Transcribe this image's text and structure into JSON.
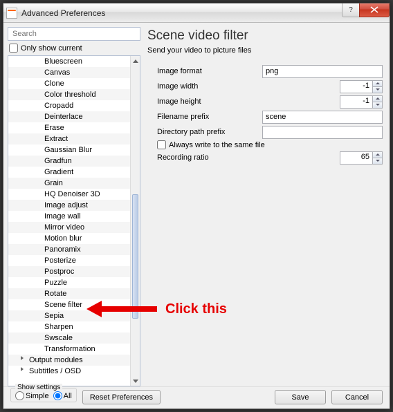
{
  "window": {
    "title": "Advanced Preferences"
  },
  "sidebar": {
    "search_placeholder": "Search",
    "only_show_current": "Only show current",
    "items": [
      {
        "label": "Bluescreen"
      },
      {
        "label": "Canvas"
      },
      {
        "label": "Clone"
      },
      {
        "label": "Color threshold"
      },
      {
        "label": "Cropadd"
      },
      {
        "label": "Deinterlace"
      },
      {
        "label": "Erase"
      },
      {
        "label": "Extract"
      },
      {
        "label": "Gaussian Blur"
      },
      {
        "label": "Gradfun"
      },
      {
        "label": "Gradient"
      },
      {
        "label": "Grain"
      },
      {
        "label": "HQ Denoiser 3D"
      },
      {
        "label": "Image adjust"
      },
      {
        "label": "Image wall"
      },
      {
        "label": "Mirror video"
      },
      {
        "label": "Motion blur"
      },
      {
        "label": "Panoramix"
      },
      {
        "label": "Posterize"
      },
      {
        "label": "Postproc"
      },
      {
        "label": "Puzzle"
      },
      {
        "label": "Rotate"
      },
      {
        "label": "Scene filter"
      },
      {
        "label": "Sepia"
      },
      {
        "label": "Sharpen"
      },
      {
        "label": "Swscale"
      },
      {
        "label": "Transformation"
      }
    ],
    "groups": [
      {
        "label": "Output modules"
      },
      {
        "label": "Subtitles / OSD"
      }
    ]
  },
  "main": {
    "heading": "Scene video filter",
    "subheading": "Send your video to picture files",
    "fields": {
      "format": {
        "label": "Image format",
        "value": "png"
      },
      "width": {
        "label": "Image width",
        "value": "-1"
      },
      "height": {
        "label": "Image height",
        "value": "-1"
      },
      "prefix": {
        "label": "Filename prefix",
        "value": "scene"
      },
      "dir": {
        "label": "Directory path prefix",
        "value": ""
      },
      "always": {
        "label": "Always write to the same file"
      },
      "ratio": {
        "label": "Recording ratio",
        "value": "65"
      }
    }
  },
  "footer": {
    "show_settings": "Show settings",
    "simple": "Simple",
    "all": "All",
    "reset": "Reset Preferences",
    "save": "Save",
    "cancel": "Cancel"
  },
  "annotation": {
    "text": "Click this"
  }
}
